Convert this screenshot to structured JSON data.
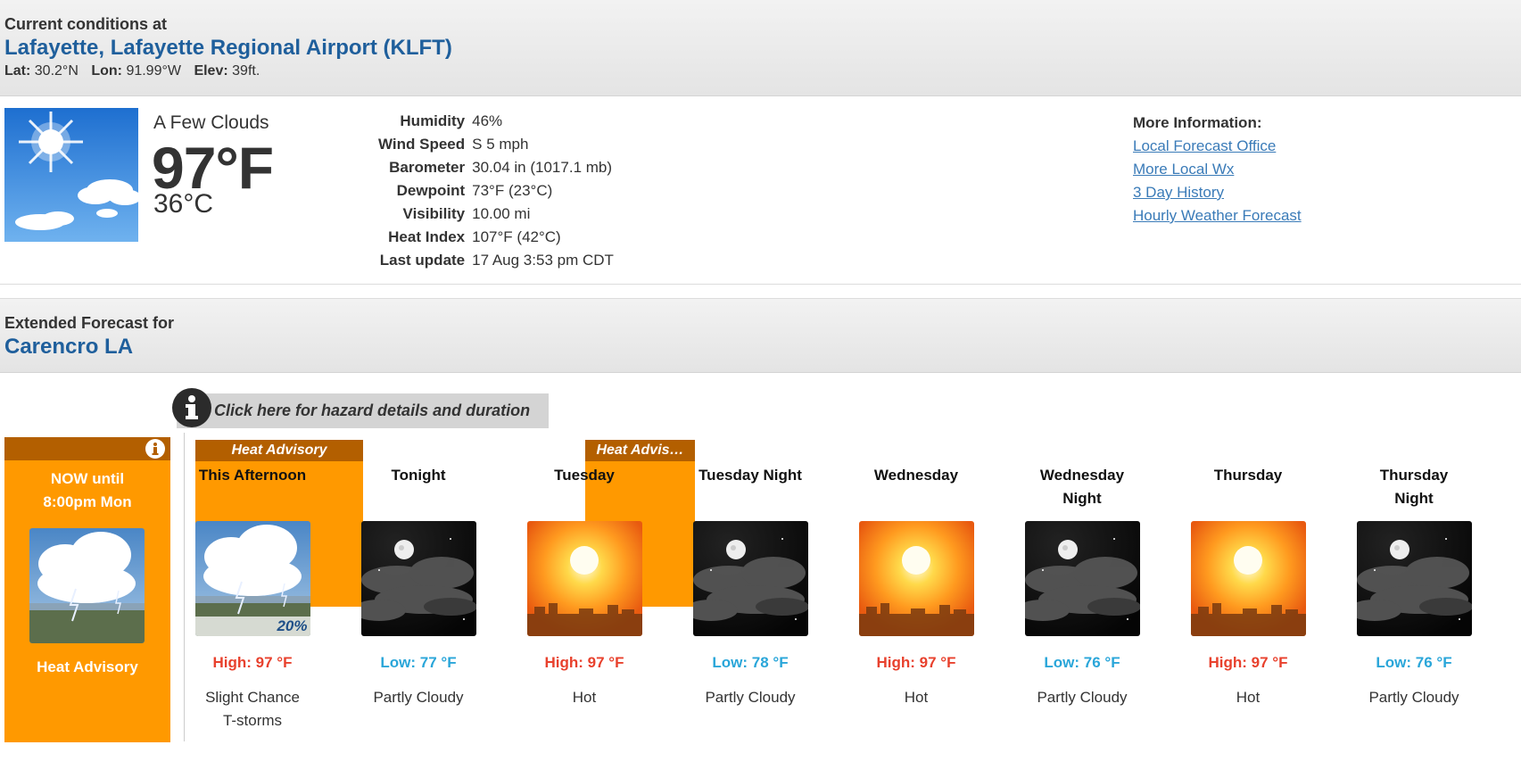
{
  "current": {
    "heading": "Current conditions at",
    "location": "Lafayette, Lafayette Regional Airport (KLFT)",
    "lat_label": "Lat:",
    "lat": "30.2°N",
    "lon_label": "Lon:",
    "lon": "91.99°W",
    "elev_label": "Elev:",
    "elev": "39ft.",
    "condition": "A Few Clouds",
    "temp_f": "97°F",
    "temp_c": "36°C",
    "details": [
      {
        "label": "Humidity",
        "value": "46%"
      },
      {
        "label": "Wind Speed",
        "value": "S 5 mph"
      },
      {
        "label": "Barometer",
        "value": "30.04 in (1017.1 mb)"
      },
      {
        "label": "Dewpoint",
        "value": "73°F (23°C)"
      },
      {
        "label": "Visibility",
        "value": "10.00 mi"
      },
      {
        "label": "Heat Index",
        "value": "107°F (42°C)"
      },
      {
        "label": "Last update",
        "value": "17 Aug 3:53 pm CDT"
      }
    ],
    "more_info": {
      "heading": "More Information:",
      "links": [
        "Local Forecast Office",
        "More Local Wx",
        "3 Day History",
        "Hourly Weather Forecast"
      ]
    }
  },
  "extended": {
    "heading": "Extended Forecast for",
    "location": "Carencro LA",
    "hazard_button": "Click here for hazard details and duration",
    "now": {
      "line1": "NOW until",
      "line2": "8:00pm Mon",
      "hazard": "Heat Advisory"
    },
    "advisory_1": "Heat Advisory",
    "advisory_2": "Heat Advis…",
    "periods": [
      {
        "name": "This Afternoon",
        "temp": "High: 97 °F",
        "desc": "Slight Chance T-storms",
        "pop": "20%"
      },
      {
        "name": "Tonight",
        "temp": "Low: 77 °F",
        "desc": "Partly Cloudy"
      },
      {
        "name": "Tuesday",
        "temp": "High: 97 °F",
        "desc": "Hot"
      },
      {
        "name": "Tuesday Night",
        "temp": "Low: 78 °F",
        "desc": "Partly Cloudy"
      },
      {
        "name": "Wednesday",
        "temp": "High: 97 °F",
        "desc": "Hot"
      },
      {
        "name": "Wednesday Night",
        "temp": "Low: 76 °F",
        "desc": "Partly Cloudy"
      },
      {
        "name": "Thursday",
        "temp": "High: 97 °F",
        "desc": "Hot"
      },
      {
        "name": "Thursday Night",
        "temp": "Low: 76 °F",
        "desc": "Partly Cloudy"
      }
    ]
  },
  "colors": {
    "title_blue": "#1f5f9c",
    "advisory_orange": "#ff9900",
    "high_red": "#e8412d",
    "low_blue": "#2aa6d9"
  }
}
